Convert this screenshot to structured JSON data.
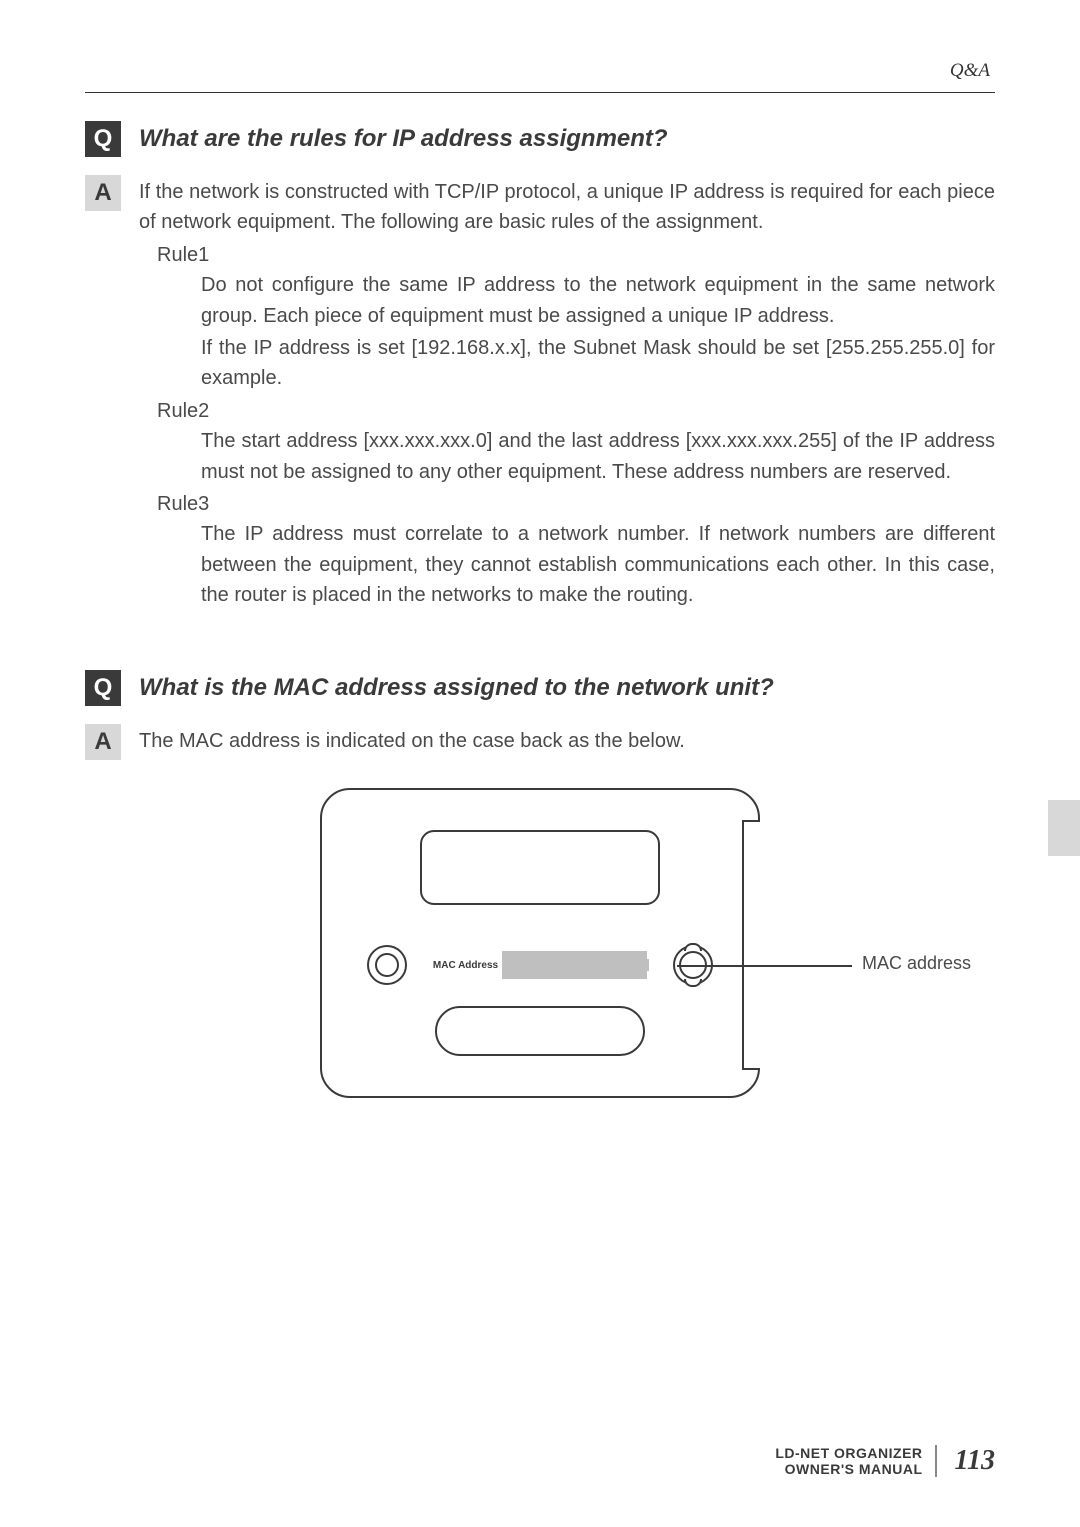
{
  "header": {
    "section": "Q&A"
  },
  "markers": {
    "q": "Q",
    "a": "A"
  },
  "qa1": {
    "question": "What are the rules for IP address assignment?",
    "intro": "If the network is constructed with TCP/IP protocol, a unique IP address is required for each piece of network equipment. The following are basic rules of the assignment.",
    "rule1_label": "Rule1",
    "rule1_p1": "Do not configure the same IP address to the network equipment in the same network group. Each piece of equipment must be assigned a unique IP address.",
    "rule1_p2": "If the IP address is set [192.168.x.x], the Subnet Mask should be set [255.255.255.0] for example.",
    "rule2_label": "Rule2",
    "rule2_p1": "The start address [xxx.xxx.xxx.0] and the last address [xxx.xxx.xxx.255] of the IP address must not be assigned to any other equipment. These address numbers are reserved.",
    "rule3_label": "Rule3",
    "rule3_p1": "The IP address must correlate to a network number. If network numbers are different between the equipment, they cannot establish communications each other. In this case, the router is placed in the networks to make the routing."
  },
  "qa2": {
    "question": "What is the MAC address assigned to the network unit?",
    "answer": "The MAC address is indicated on the case back as the below."
  },
  "diagram": {
    "mac_label": "MAC Address",
    "pointer": "MAC address"
  },
  "footer": {
    "product": "LD-NET ORGANIZER",
    "manual": "OWNER'S MANUAL",
    "page": "113"
  }
}
